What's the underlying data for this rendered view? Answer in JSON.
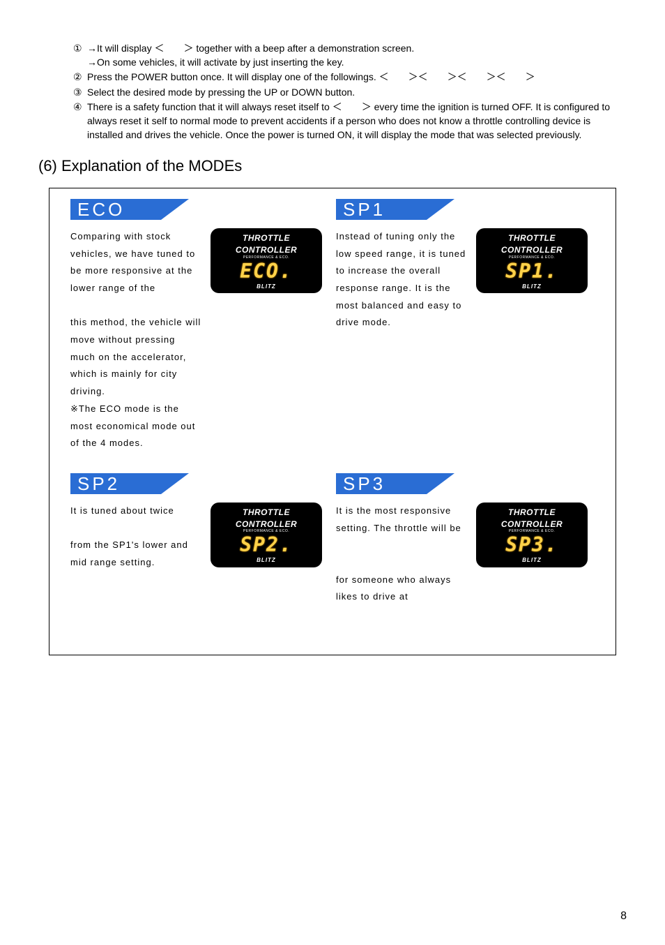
{
  "steps": {
    "s1_num": "①",
    "s1_line1": "→It will display ＜　　＞ together with a beep after a demonstration screen.",
    "s1_line2": "→On some vehicles, it will activate by just inserting the key.",
    "s2_num": "②",
    "s2_text": "Press the POWER button once.  It will display one of the followings. ＜　　＞＜　　＞＜　　＞＜　　＞",
    "s3_num": "③",
    "s3_text": "Select the desired mode by pressing the UP or DOWN button.",
    "s4_num": "④",
    "s4_text": "There is a safety function that it will always reset itself to ＜　　＞ every time the ignition is turned OFF.  It is configured to always reset it self to normal mode to prevent accidents if a person who does not know a throttle controlling device is installed and drives the vehicle.  Once the power is turned ON, it will display the mode that was selected previously."
  },
  "section_title": "(6) Explanation of the MODEs",
  "device": {
    "title": "THROTTLE CONTROLLER",
    "sub": "PERFORMANCE & ECO.",
    "brand": "BLITZ"
  },
  "modes": {
    "eco": {
      "label": "ECO",
      "display": "ECO.",
      "text": "Comparing with stock vehicles, we have tuned to be more responsive at the lower range of the\n\nthis method, the vehicle will move without pressing much on the accelerator, which is mainly for city driving.\n※The ECO mode is the most economical mode out of the 4 modes."
    },
    "sp1": {
      "label": "SP1",
      "display": "SP1.",
      "text": "Instead of tuning only the low speed range, it is tuned to increase the overall response range.  It is the most balanced and easy to drive mode."
    },
    "sp2": {
      "label": "SP2",
      "display": "SP2.",
      "text": "It is tuned about twice\n\nfrom the SP1's lower and mid range setting."
    },
    "sp3": {
      "label": "SP3",
      "display": "SP3.",
      "text": "It is the most responsive setting.  The throttle will be\n\n\nfor someone who always likes to drive at"
    }
  },
  "page_number": "8"
}
